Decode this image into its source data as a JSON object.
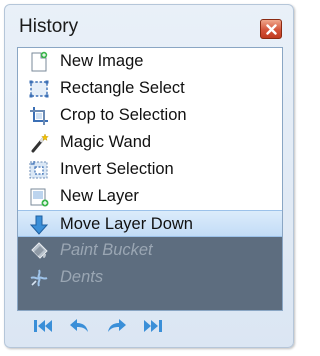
{
  "window": {
    "title": "History",
    "close_label": "Close"
  },
  "history": {
    "items": [
      {
        "label": "New Image",
        "icon": "new-image-icon",
        "state": "active"
      },
      {
        "label": "Rectangle Select",
        "icon": "rectangle-select-icon",
        "state": "active"
      },
      {
        "label": "Crop to Selection",
        "icon": "crop-icon",
        "state": "active"
      },
      {
        "label": "Magic Wand",
        "icon": "magic-wand-icon",
        "state": "active"
      },
      {
        "label": "Invert Selection",
        "icon": "invert-selection-icon",
        "state": "active"
      },
      {
        "label": "New Layer",
        "icon": "new-layer-icon",
        "state": "active"
      },
      {
        "label": "Move Layer Down",
        "icon": "move-layer-down-icon",
        "state": "selected"
      },
      {
        "label": "Paint Bucket",
        "icon": "paint-bucket-icon",
        "state": "undone"
      },
      {
        "label": "Dents",
        "icon": "dents-icon",
        "state": "undone"
      }
    ]
  },
  "toolbar": {
    "buttons": [
      {
        "icon": "rewind-to-start-icon"
      },
      {
        "icon": "undo-icon"
      },
      {
        "icon": "redo-icon"
      },
      {
        "icon": "fast-forward-to-end-icon"
      }
    ]
  },
  "colors": {
    "selected_row": "#c2dcf6",
    "undone_row": "#5d6d7f",
    "toolbar_icon": "#3a8fd8",
    "close_button": "#d4543a"
  }
}
